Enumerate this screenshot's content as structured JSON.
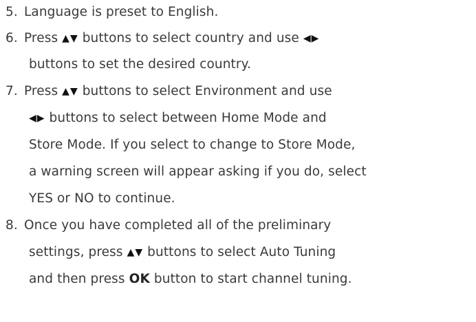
{
  "steps": [
    {
      "number": "5.",
      "lines": [
        {
          "parts": [
            {
              "t": "text",
              "v": "Language is preset to English."
            }
          ]
        }
      ]
    },
    {
      "number": "6.",
      "lines": [
        {
          "parts": [
            {
              "t": "text",
              "v": "Press "
            },
            {
              "t": "icon",
              "name": "up-down-arrows-icon",
              "v": "▲▼"
            },
            {
              "t": "text",
              "v": " buttons to select country and use "
            },
            {
              "t": "icon",
              "name": "left-right-arrows-icon",
              "v": "◀▶"
            }
          ]
        },
        {
          "parts": [
            {
              "t": "text",
              "v": "buttons to set the desired country."
            }
          ]
        }
      ]
    },
    {
      "number": "7.",
      "lines": [
        {
          "parts": [
            {
              "t": "text",
              "v": "Press "
            },
            {
              "t": "icon",
              "name": "up-down-arrows-icon",
              "v": "▲▼"
            },
            {
              "t": "text",
              "v": " buttons to select Environment and use"
            }
          ]
        },
        {
          "parts": [
            {
              "t": "icon",
              "name": "left-right-arrows-icon",
              "v": "◀▶"
            },
            {
              "t": "text",
              "v": " buttons to select between Home Mode and"
            }
          ]
        },
        {
          "parts": [
            {
              "t": "text",
              "v": "Store Mode. If you select to change to Store Mode,"
            }
          ]
        },
        {
          "parts": [
            {
              "t": "text",
              "v": "a warning screen will appear asking if you do, select"
            }
          ]
        },
        {
          "parts": [
            {
              "t": "text",
              "v": "YES or NO to continue."
            }
          ]
        }
      ]
    },
    {
      "number": "8.",
      "lines": [
        {
          "parts": [
            {
              "t": "text",
              "v": "Once you have completed all of the preliminary"
            }
          ]
        },
        {
          "parts": [
            {
              "t": "text",
              "v": "settings, press "
            },
            {
              "t": "icon",
              "name": "up-down-arrows-icon",
              "v": "▲▼"
            },
            {
              "t": "text",
              "v": " buttons to select Auto Tuning"
            }
          ]
        },
        {
          "parts": [
            {
              "t": "text",
              "v": "and then press "
            },
            {
              "t": "bold",
              "v": "OK"
            },
            {
              "t": "text",
              "v": " button to start channel tuning."
            }
          ]
        }
      ]
    }
  ]
}
